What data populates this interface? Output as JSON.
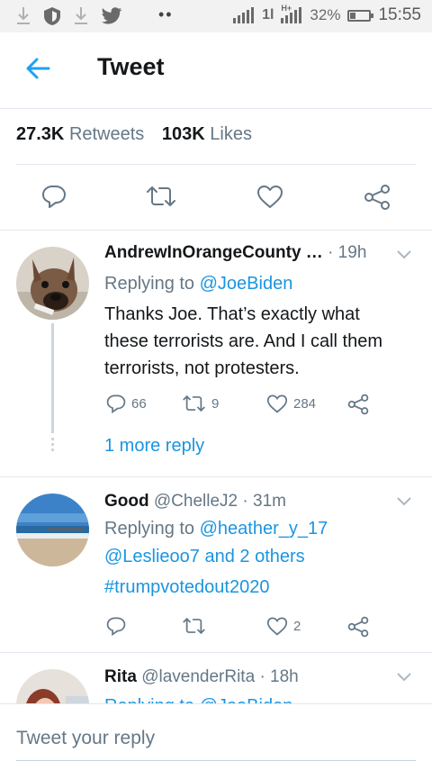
{
  "status_bar": {
    "battery": "32%",
    "battery_level": 0.32,
    "time": "15:55",
    "network_label": "1l",
    "signal2_label": "H+"
  },
  "header": {
    "title": "Tweet"
  },
  "stats": {
    "retweets_count": "27.3K",
    "retweets_label": "Retweets",
    "likes_count": "103K",
    "likes_label": "Likes"
  },
  "replies": [
    {
      "name": "AndrewInOrangeCounty …",
      "time": "· 19h",
      "replying_prefix": "Replying to ",
      "replying_to": "@JoeBiden",
      "lines": [
        "Thanks Joe.  That’s exactly what",
        "these terrorists are.  And I call them",
        "terrorists, not protesters."
      ],
      "reply_count": "66",
      "retweet_count": "9",
      "like_count": "284",
      "more_replies": "1 more reply"
    },
    {
      "name": "Good",
      "handle": "@ChelleJ2",
      "time": "· 31m",
      "replying_prefix": "Replying to ",
      "replying_to": "@heather_y_17",
      "replying_line2_handle": "@Leslieoo7",
      "replying_line2_rest": " and 2 others",
      "hashtag": "#trumpvotedout2020",
      "like_count": "2"
    },
    {
      "name": "Rita",
      "handle": "@lavenderRita",
      "time": "· 18h",
      "replying_partial": "Replying to @JoeBiden"
    }
  ],
  "composer": {
    "placeholder": "Tweet your reply"
  },
  "colors": {
    "accent": "#1da1f2",
    "link": "#1b95e0",
    "secondary_text": "#657786",
    "divider": "#e1e8ed"
  },
  "icons": [
    "download-icon",
    "shield-icon",
    "twitter-bird-icon",
    "signal-icon",
    "back-arrow-icon",
    "reply-icon",
    "retweet-icon",
    "like-icon",
    "share-icon",
    "chevron-down-icon"
  ]
}
